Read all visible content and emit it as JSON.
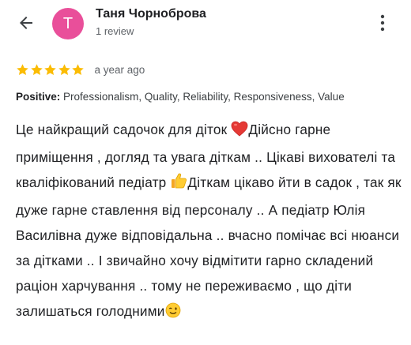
{
  "header": {
    "avatar_letter": "T",
    "avatar_color": "#e94f9a",
    "reviewer_name": "Таня Чорноброва",
    "review_count": "1 review"
  },
  "icons": {
    "back": "arrow-left-icon",
    "more": "more-vert-icon",
    "star": "star-icon",
    "heart": "red-heart-emoji",
    "thumbs_up": "thumbs-up-emoji",
    "wink": "winking-face-emoji"
  },
  "rating": {
    "stars": 5,
    "max": 5,
    "star_color": "#fbbc04",
    "time": "a year ago"
  },
  "positive": {
    "label": "Positive:",
    "values": "Professionalism, Quality, Reliability, Responsiveness, Value"
  },
  "review": {
    "part1": "Це найкращий садочок для діток ",
    "part2": "Дійсно гарне приміщення , догляд та увага діткам .. Цікаві вихователі та кваліфікований педіатр ",
    "part3": "Діткам цікаво йти в садок , так як дуже гарне ставлення від персоналу .. А педіатр Юлія Василівна дуже відповідальна .. вчасно помічає всі нюанси за дітками .. І звичайно хочу відмітити гарно складений раціон харчування .. тому не переживаємо , що діти залишаться голодними"
  }
}
